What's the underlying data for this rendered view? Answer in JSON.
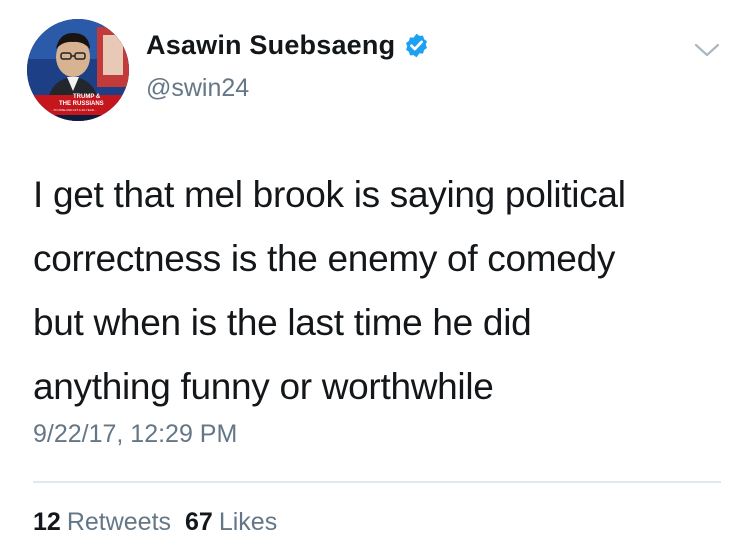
{
  "author": {
    "display_name": "Asawin Suebsaeng",
    "handle": "@swin24",
    "verified": true
  },
  "avatar": {
    "banner_line1": "TRUMP &",
    "banner_line2": "THE RUSSIANS",
    "banner_line3": "...TO RISE AND HIT A 40-YEAR..."
  },
  "tweet": {
    "lines": [
      "I get that mel brook is saying political",
      "correctness is the enemy of comedy",
      "but when is the last time he did",
      "anything funny or worthwhile"
    ],
    "timestamp": "9/22/17, 12:29 PM"
  },
  "stats": {
    "retweets_count": "12",
    "retweets_label": "Retweets",
    "likes_count": "67",
    "likes_label": "Likes"
  },
  "icons": {
    "verified": "verified-badge-icon",
    "menu": "chevron-down-icon"
  },
  "colors": {
    "text": "#14171a",
    "secondary": "#657786",
    "verified_blue": "#1da1f2",
    "divider": "#e1e8ed"
  }
}
